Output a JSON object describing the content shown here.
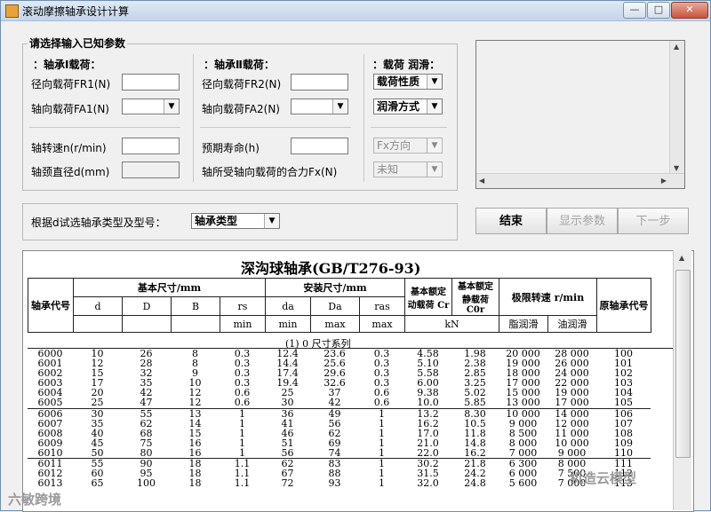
{
  "window": {
    "title": "滚动摩擦轴承设计计算",
    "min": "—",
    "max": "□",
    "close": "✕"
  },
  "params": {
    "legend": "请选择输入已知参数",
    "load1": {
      "heading": "：轴承Ⅰ载荷：",
      "radial_label": "径向载荷FR1(N)",
      "axial_label": "轴向载荷FA1(N)"
    },
    "load2": {
      "heading": "：轴承Ⅱ载荷：",
      "radial_label": "径向载荷FR2(N)",
      "axial_label": "轴向载荷FA2(N)"
    },
    "load3": {
      "heading": "：载荷 润滑：",
      "load_type": "载荷性质",
      "lube_type": "润滑方式"
    },
    "speed_label": "轴转速n(r/min)",
    "diameter_label": "轴颈直径d(mm)",
    "life_label": "预期寿命(h)",
    "fx_label": "轴所受轴向载荷的合力Fx(N)",
    "fx_dir": "Fx方向",
    "unknown": "未知"
  },
  "selector": {
    "label": "根据d试选轴承类型及型号：",
    "value": "轴承类型"
  },
  "buttons": {
    "end": "结束",
    "show": "显示参数",
    "next": "下一步"
  },
  "table": {
    "title": "深沟球轴承(GB/T276-93)",
    "h_code": "轴承代号",
    "h_basic_dim": "基本尺寸/mm",
    "h_install_dim": "安装尺寸/mm",
    "h_dyn": "基本额定动载荷 Cr",
    "h_static": "基本额定静载荷 C0r",
    "h_speed": "极限转速 r/min",
    "h_orig": "原轴承代号",
    "cols": [
      "d",
      "D",
      "B",
      "rs",
      "da",
      "Da",
      "ras"
    ],
    "sub": [
      "",
      "",
      "",
      "min",
      "min",
      "max",
      "max"
    ],
    "unit": "kN",
    "grease": "脂润滑",
    "oil": "油润滑",
    "series": "(1) 0 尺寸系列",
    "rows": [
      [
        "6000",
        "10",
        "26",
        "8",
        "0.3",
        "12.4",
        "23.6",
        "0.3",
        "4.58",
        "1.98",
        "20 000",
        "28 000",
        "100"
      ],
      [
        "6001",
        "12",
        "28",
        "8",
        "0.3",
        "14.4",
        "25.6",
        "0.3",
        "5.10",
        "2.38",
        "19 000",
        "26 000",
        "101"
      ],
      [
        "6002",
        "15",
        "32",
        "9",
        "0.3",
        "17.4",
        "29.6",
        "0.3",
        "5.58",
        "2.85",
        "18 000",
        "24 000",
        "102"
      ],
      [
        "6003",
        "17",
        "35",
        "10",
        "0.3",
        "19.4",
        "32.6",
        "0.3",
        "6.00",
        "3.25",
        "17 000",
        "22 000",
        "103"
      ],
      [
        "6004",
        "20",
        "42",
        "12",
        "0.6",
        "25",
        "37",
        "0.6",
        "9.38",
        "5.02",
        "15 000",
        "19 000",
        "104"
      ],
      [
        "6005",
        "25",
        "47",
        "12",
        "0.6",
        "30",
        "42",
        "0.6",
        "10.0",
        "5.85",
        "13 000",
        "17 000",
        "105"
      ],
      [
        "6006",
        "30",
        "55",
        "13",
        "1",
        "36",
        "49",
        "1",
        "13.2",
        "8.30",
        "10 000",
        "14 000",
        "106"
      ],
      [
        "6007",
        "35",
        "62",
        "14",
        "1",
        "41",
        "56",
        "1",
        "16.2",
        "10.5",
        "9 000",
        "12 000",
        "107"
      ],
      [
        "6008",
        "40",
        "68",
        "15",
        "1",
        "46",
        "62",
        "1",
        "17.0",
        "11.8",
        "8 500",
        "11 000",
        "108"
      ],
      [
        "6009",
        "45",
        "75",
        "16",
        "1",
        "51",
        "69",
        "1",
        "21.0",
        "14.8",
        "8 000",
        "10 000",
        "109"
      ],
      [
        "6010",
        "50",
        "80",
        "16",
        "1",
        "56",
        "74",
        "1",
        "22.0",
        "16.2",
        "7 000",
        "9 000",
        "110"
      ],
      [
        "6011",
        "55",
        "90",
        "18",
        "1.1",
        "62",
        "83",
        "1",
        "30.2",
        "21.8",
        "6 300",
        "8 000",
        "111"
      ],
      [
        "6012",
        "60",
        "95",
        "18",
        "1.1",
        "67",
        "88",
        "1",
        "31.5",
        "24.2",
        "6 000",
        "7 500",
        "112"
      ],
      [
        "6013",
        "65",
        "100",
        "18",
        "1.1",
        "72",
        "93",
        "1",
        "32.0",
        "24.8",
        "5 600",
        "7 000",
        "113"
      ]
    ]
  },
  "watermarks": {
    "left": "六敏跨境",
    "right": "机造云模型"
  }
}
